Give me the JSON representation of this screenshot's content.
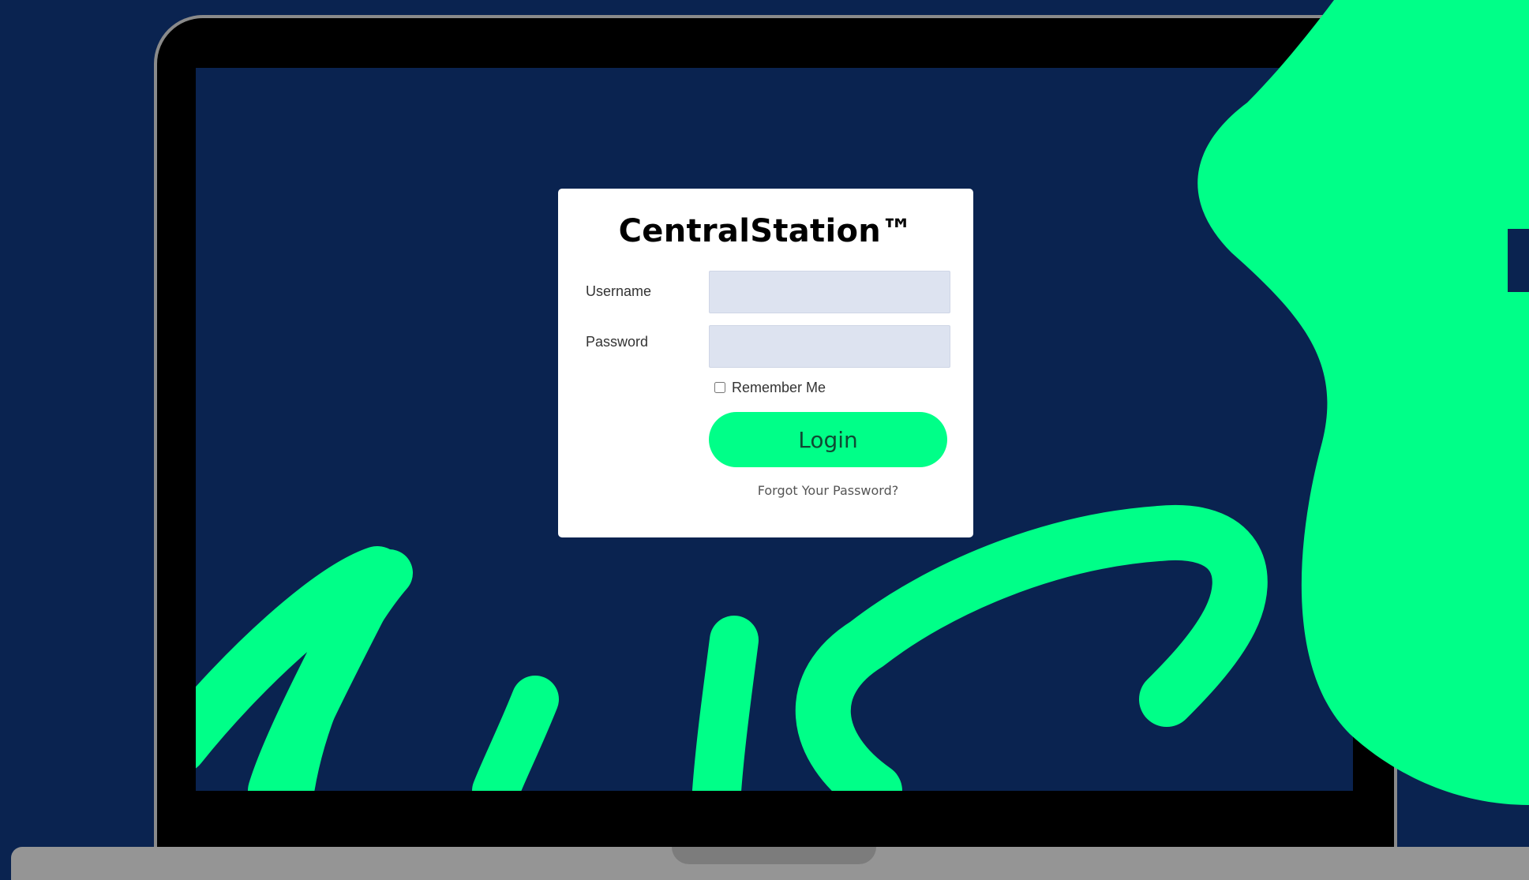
{
  "app": {
    "title": "CentralStation™"
  },
  "form": {
    "username_label": "Username",
    "username_value": "",
    "password_label": "Password",
    "password_value": "",
    "remember_label": "Remember Me",
    "remember_checked": false,
    "login_label": "Login",
    "forgot_label": "Forgot Your Password?"
  },
  "colors": {
    "background": "#0a2350",
    "accent": "#00ff88",
    "laptop_frame": "#000000",
    "laptop_base": "#959595",
    "input_fill": "#dde3f0"
  },
  "icons": {
    "checkbox": "checkbox-icon"
  }
}
